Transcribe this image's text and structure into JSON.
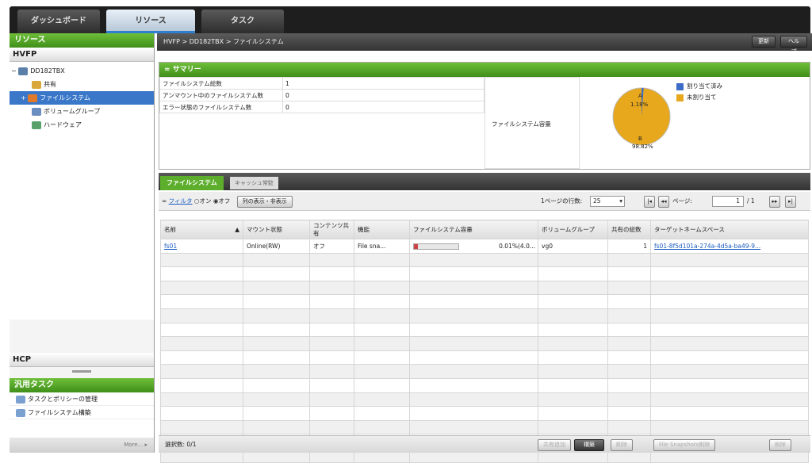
{
  "tabs": [
    {
      "label": "ダッシュボード"
    },
    {
      "label": "リソース"
    },
    {
      "label": "タスク"
    }
  ],
  "left": {
    "title": "リソース",
    "section_hvfp": "HVFP",
    "tree": [
      {
        "label": "DD182TBX",
        "icon": "server-icon"
      },
      {
        "label": "共有",
        "icon": "share-icon"
      },
      {
        "label": "ファイルシステム",
        "icon": "filesystem-icon"
      },
      {
        "label": "ボリュームグループ",
        "icon": "volume-group-icon"
      },
      {
        "label": "ハードウェア",
        "icon": "hardware-icon"
      }
    ],
    "section_hcp": "HCP",
    "tasks_title": "汎用タスク",
    "tasks": [
      {
        "label": "タスクとポリシーの管理"
      },
      {
        "label": "ファイルシステム構築"
      }
    ],
    "more": "More..."
  },
  "breadcrumb": "HVFP > DD182TBX > ファイルシステム",
  "header_buttons": {
    "refresh": "更新",
    "help": "ヘルプ"
  },
  "summary": {
    "title": "サマリー",
    "rows": [
      {
        "label": "ファイルシステム総数",
        "value": "1"
      },
      {
        "label": "アンマウント中のファイルシステム数",
        "value": "0"
      },
      {
        "label": "エラー状態のファイルシステム数",
        "value": "0"
      }
    ],
    "usage_label": "ファイルシステム容量",
    "pie": {
      "a_label": "A",
      "a_pct": "1.18%",
      "b_label": "B",
      "b_pct": "98.82%",
      "a_fraction": 0.0118,
      "colors": {
        "a": "#3d6cc7",
        "b": "#e8a81d"
      }
    },
    "legend": [
      {
        "label": "割り当て済み",
        "color": "#3d6cc7",
        "key": "A"
      },
      {
        "label": "未割り当て",
        "color": "#e8a81d",
        "key": "B"
      }
    ]
  },
  "content_tabs": [
    {
      "label": "ファイルシステム"
    },
    {
      "label": "キャッシュ常駐"
    }
  ],
  "toolbar": {
    "filter": "フィルタ",
    "on": "オン",
    "off": "オフ",
    "columns_button": "列の表示・非表示",
    "rows_per_page_label": "1ページの行数:",
    "rows_per_page_value": "25",
    "page_label": "ページ:",
    "page_value": "1",
    "page_total": "/ 1"
  },
  "table": {
    "headers": [
      "名前",
      "マウント状態",
      "コンテンツ共有",
      "機能",
      "ファイルシステム容量",
      "ボリュームグループ",
      "共有の総数",
      "ターゲットネームスペース"
    ],
    "rows": [
      {
        "name": "fs01",
        "mount": "Online(RW)",
        "content_share": "オフ",
        "function": "File sna...",
        "capacity": "0.01%(4.0...",
        "capacity_fraction": 0.0118,
        "volume_group": "vg0",
        "share_count": "1",
        "namespace": "fs01-8f5d101a-274a-4d5a-ba49-9..."
      }
    ]
  },
  "footer": {
    "selected_label": "選択数:",
    "selected_value": "0/1",
    "buttons": [
      "共有追加",
      "構築",
      "削除",
      "File Snapshots削除",
      "削除"
    ]
  }
}
